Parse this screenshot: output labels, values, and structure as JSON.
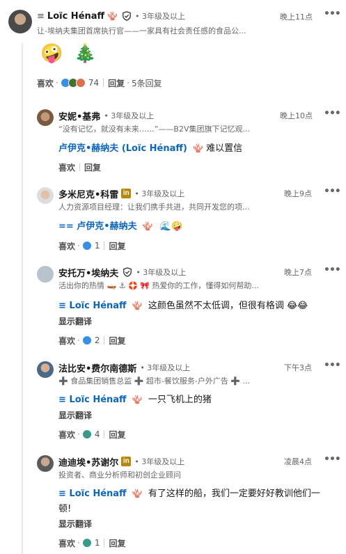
{
  "colors": {
    "link": "#0a66c2",
    "muted": "#666666"
  },
  "top": {
    "prefix": "≡",
    "name": "Loïc Hénaff",
    "badge": "🪸",
    "degree": "• 3年级及以上",
    "time": "晚上11点",
    "headline": "让-埃纳夫集团首席执行官——一家具有社会责任感的食品公...",
    "emojis": [
      "🤪",
      "🎄"
    ],
    "like": "喜欢",
    "reaction_count": "74",
    "reply": "回复",
    "reply_count": "5条回复"
  },
  "replies": [
    {
      "name": "安妮•基弗",
      "degree": "• 3年级及以上",
      "time": "晚上10点",
      "headline": "“没有记忆，就没有未来……”——B2V集团旗下记忆观...",
      "mention": "卢伊克•赫纳夫 (Loïc Hénaff)",
      "badge": "🪸",
      "text": "难以置信",
      "like": "喜欢",
      "reply": "回复"
    },
    {
      "name": "多米尼克•科雷",
      "degree": "• 3年级及以上",
      "time": "晚上9点",
      "headline": "人力资源项目经理：让我们携手共进，共同开发您的项...",
      "mention": "== 卢伊克•赫纳夫",
      "badge": "🪸",
      "text": "🌊🤪",
      "like": "喜欢",
      "count": "1",
      "reply": "回复"
    },
    {
      "name": "安托万•埃纳夫",
      "degree": "• 3年级及以上",
      "time": "晚上7点",
      "headline": "活出你的热情 🛶 ⚓ 🛟 🎀 热爱你的工作，懂得如何帮助...",
      "mention": "≡ Loïc Hénaff",
      "badge": "🪸",
      "text": "这颜色虽然不太低调，但很有格调 😂😂",
      "translate": "显示翻译",
      "like": "喜欢",
      "count": "2",
      "reply": "回复"
    },
    {
      "name": "法比安•费尔南德斯",
      "degree": "• 3年级及以上",
      "time": "下午3点",
      "headline": "➕ 食品集团销售总监 ➕ 超市-餐饮服务-户外广告 ➕ ...",
      "mention": "≡ Loïc Hénaff",
      "badge": "🪸",
      "text": "一只飞机上的猪",
      "translate": "显示翻译",
      "like": "喜欢",
      "count": "4",
      "reply": "回复"
    },
    {
      "name": "迪迪埃•苏谢尔",
      "degree": "• 3年级及以上",
      "time": "凌晨4点",
      "headline": "投资者、商业分析师和初创企业顾问",
      "mention": "≡ Loïc Hénaff",
      "badge": "🪸",
      "text": "有了这样的船，我们一定要好好教训他们一",
      "text2": "顿!",
      "translate": "显示翻译",
      "like": "喜欢",
      "count": "1",
      "reply": "回复"
    }
  ]
}
